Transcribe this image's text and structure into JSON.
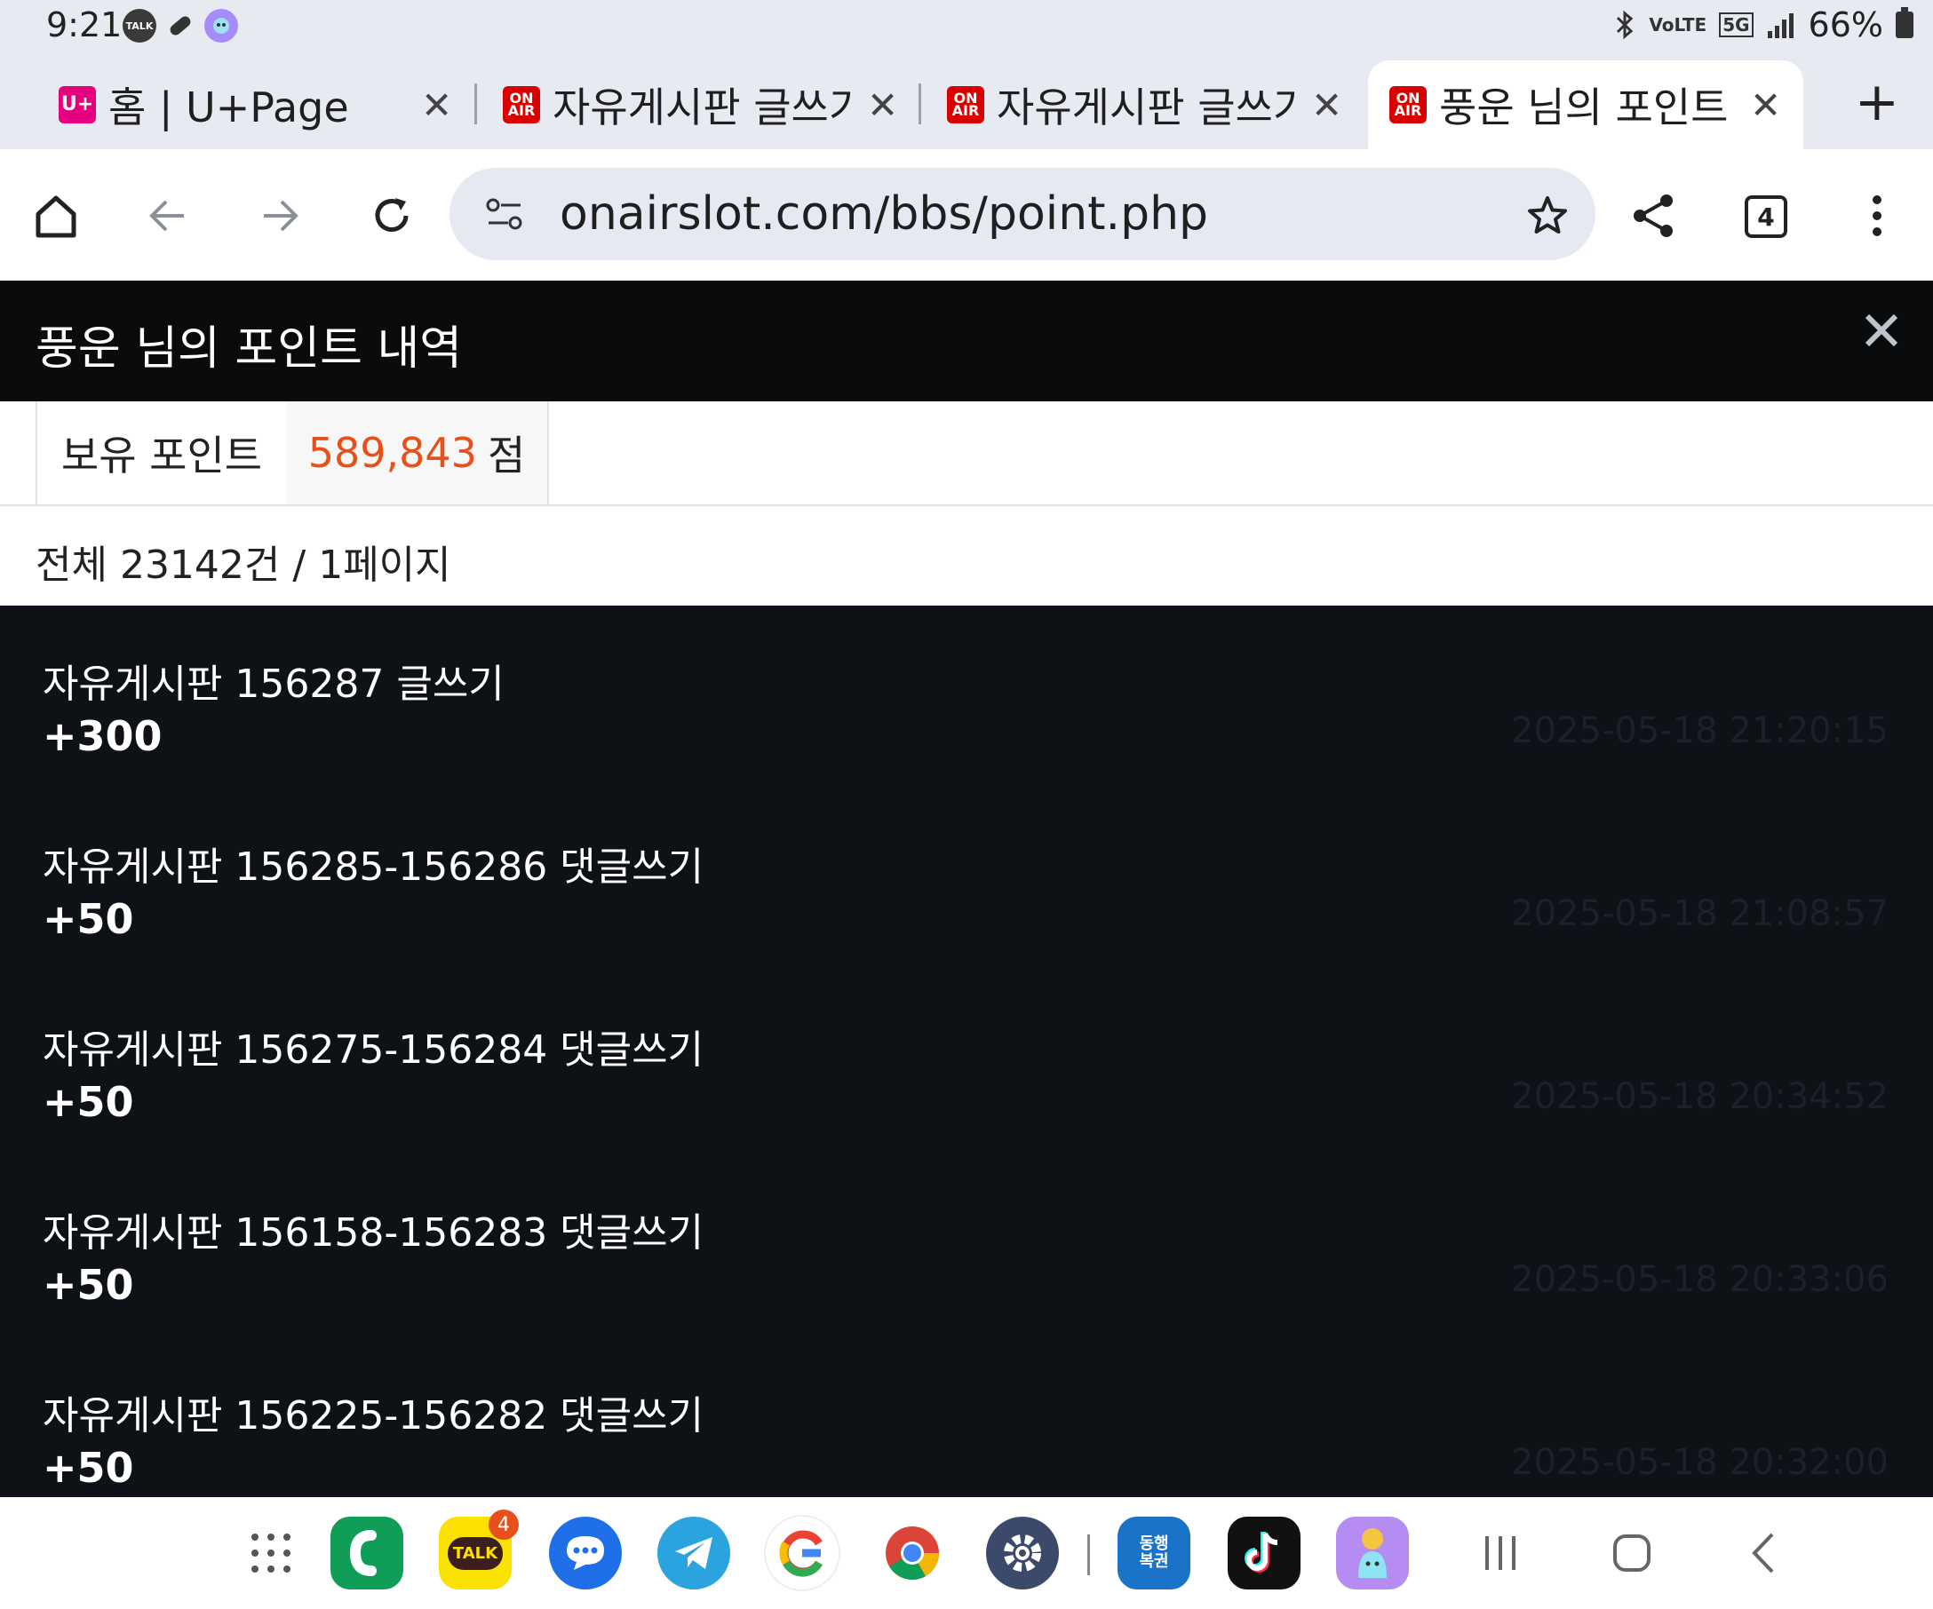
{
  "status_bar": {
    "time": "9:21",
    "talk_badge": "TALK",
    "network_label": "VoLTE",
    "network_5g": "5G",
    "battery": "66%"
  },
  "tabs": [
    {
      "title": "홈 | U+Page",
      "favicon": "U+"
    },
    {
      "title": "자유게시판 글쓰기",
      "favicon": "ON AIR"
    },
    {
      "title": "자유게시판 글쓰기",
      "favicon": "ON AIR"
    },
    {
      "title": "풍운 님의 포인트",
      "favicon": "ON AIR",
      "active": true
    }
  ],
  "toolbar": {
    "url": "onairslot.com/bbs/point.php",
    "tab_count": "4"
  },
  "page": {
    "title": "풍운 님의 포인트 내역",
    "points_label": "보유 포인트",
    "points_value": "589,843",
    "points_unit": "점",
    "summary": "전체 23142건 / 1페이지"
  },
  "entries": [
    {
      "desc": "자유게시판 156287 글쓰기",
      "amount": "+300",
      "date": "2025-05-18 21:20:15"
    },
    {
      "desc": "자유게시판 156285-156286 댓글쓰기",
      "amount": "+50",
      "date": "2025-05-18 21:08:57"
    },
    {
      "desc": "자유게시판 156275-156284 댓글쓰기",
      "amount": "+50",
      "date": "2025-05-18 20:34:52"
    },
    {
      "desc": "자유게시판 156158-156283 댓글쓰기",
      "amount": "+50",
      "date": "2025-05-18 20:33:06"
    },
    {
      "desc": "자유게시판 156225-156282 댓글쓰기",
      "amount": "+50",
      "date": "2025-05-18 20:32:00"
    }
  ],
  "dock": {
    "kakao_label": "TALK",
    "kakao_badge": "4",
    "donghaeng_label": "동행 복권"
  },
  "colors": {
    "accent_points": "#e8501b",
    "header_bg": "#0a0b0d",
    "list_bg": "#0e1116"
  }
}
